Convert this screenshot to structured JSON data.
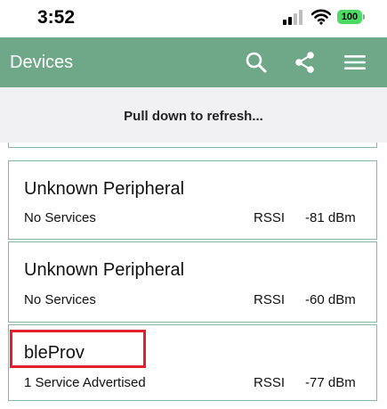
{
  "status_bar": {
    "time": "3:52",
    "battery": "100"
  },
  "header": {
    "title": "Devices",
    "icons": [
      "search-icon",
      "share-icon",
      "menu-icon"
    ]
  },
  "refresh": {
    "text": "Pull down to refresh..."
  },
  "devices": [
    {
      "name": "Unknown Peripheral",
      "services": "No Services",
      "rssi_label": "RSSI",
      "rssi_value": "-81 dBm"
    },
    {
      "name": "Unknown Peripheral",
      "services": "No Services",
      "rssi_label": "RSSI",
      "rssi_value": "-60 dBm"
    },
    {
      "name": "bleProv",
      "services": "1 Service Advertised",
      "rssi_label": "RSSI",
      "rssi_value": "-77 dBm"
    }
  ],
  "colors": {
    "app_bar": "#6fa888",
    "card_border": "#86b8a0",
    "highlight": "#e0202a",
    "battery": "#4cd964"
  }
}
